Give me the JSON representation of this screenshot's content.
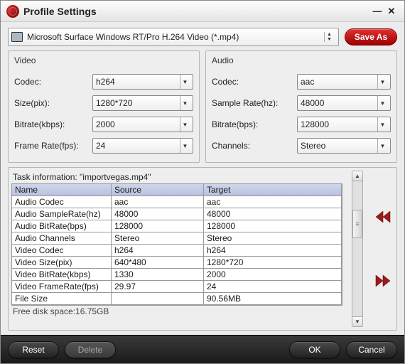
{
  "window": {
    "title": "Profile Settings"
  },
  "profile": {
    "selected": "Microsoft Surface Windows RT/Pro H.264 Video (*.mp4)",
    "save_as_label": "Save As"
  },
  "video": {
    "group_label": "Video",
    "codec_label": "Codec:",
    "codec_value": "h264",
    "size_label": "Size(pix):",
    "size_value": "1280*720",
    "bitrate_label": "Bitrate(kbps):",
    "bitrate_value": "2000",
    "framerate_label": "Frame Rate(fps):",
    "framerate_value": "24"
  },
  "audio": {
    "group_label": "Audio",
    "codec_label": "Codec:",
    "codec_value": "aac",
    "samplerate_label": "Sample Rate(hz):",
    "samplerate_value": "48000",
    "bitrate_label": "Bitrate(bps):",
    "bitrate_value": "128000",
    "channels_label": "Channels:",
    "channels_value": "Stereo"
  },
  "task": {
    "info_label": "Task information: \"importvegas.mp4\"",
    "headers": {
      "name": "Name",
      "source": "Source",
      "target": "Target"
    },
    "rows": [
      {
        "name": "Audio Codec",
        "source": "aac",
        "target": "aac"
      },
      {
        "name": "Audio SampleRate(hz)",
        "source": "48000",
        "target": "48000"
      },
      {
        "name": "Audio BitRate(bps)",
        "source": "128000",
        "target": "128000"
      },
      {
        "name": "Audio Channels",
        "source": "Stereo",
        "target": "Stereo"
      },
      {
        "name": "Video Codec",
        "source": "h264",
        "target": "h264"
      },
      {
        "name": "Video Size(pix)",
        "source": "640*480",
        "target": "1280*720"
      },
      {
        "name": "Video BitRate(kbps)",
        "source": "1330",
        "target": "2000"
      },
      {
        "name": "Video FrameRate(fps)",
        "source": "29.97",
        "target": "24"
      },
      {
        "name": "File Size",
        "source": "",
        "target": "90.56MB"
      }
    ],
    "free_disk": "Free disk space:16.75GB"
  },
  "footer": {
    "reset": "Reset",
    "delete": "Delete",
    "ok": "OK",
    "cancel": "Cancel"
  }
}
